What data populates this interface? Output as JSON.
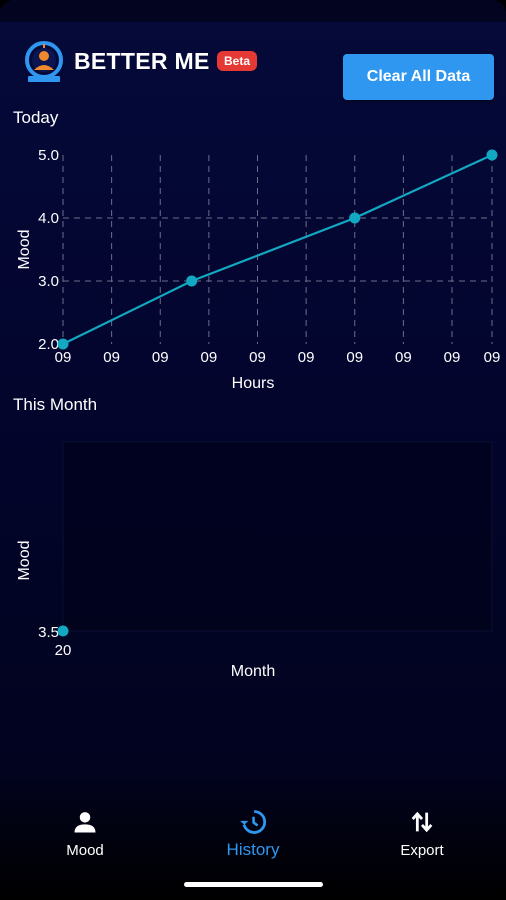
{
  "app": {
    "title": "BETTER ME",
    "badge": "Beta",
    "clear_button": "Clear All Data"
  },
  "colors": {
    "accent": "#2f97f0",
    "series": "#13a8c2",
    "badge": "#e53935",
    "background": "#03052e"
  },
  "sections": {
    "today": "Today",
    "month": "This Month"
  },
  "chart_data": [
    {
      "type": "line",
      "title": "Today",
      "xlabel": "Hours",
      "ylabel": "Mood",
      "ylim": [
        2.0,
        5.0
      ],
      "y_ticks": [
        "2.0",
        "3.0",
        "4.0",
        "5.0"
      ],
      "x_ticks": [
        "09",
        "09",
        "09",
        "09",
        "09",
        "09",
        "09",
        "09",
        "09",
        "09"
      ],
      "grid": true,
      "series": [
        {
          "x": [
            0,
            0.3,
            0.68,
            1.0
          ],
          "y": [
            2.0,
            3.0,
            4.0,
            5.0
          ]
        }
      ]
    },
    {
      "type": "scatter",
      "title": "This Month",
      "xlabel": "Month",
      "ylabel": "Mood",
      "y_ticks": [
        "3.5"
      ],
      "x_ticks": [
        "20"
      ],
      "grid": false,
      "series": [
        {
          "x": [
            20
          ],
          "y": [
            3.5
          ]
        }
      ]
    }
  ],
  "nav": {
    "items": [
      {
        "label": "Mood",
        "icon": "person-icon",
        "active": false
      },
      {
        "label": "History",
        "icon": "history-icon",
        "active": true
      },
      {
        "label": "Export",
        "icon": "swap-vertical-icon",
        "active": false
      }
    ]
  }
}
